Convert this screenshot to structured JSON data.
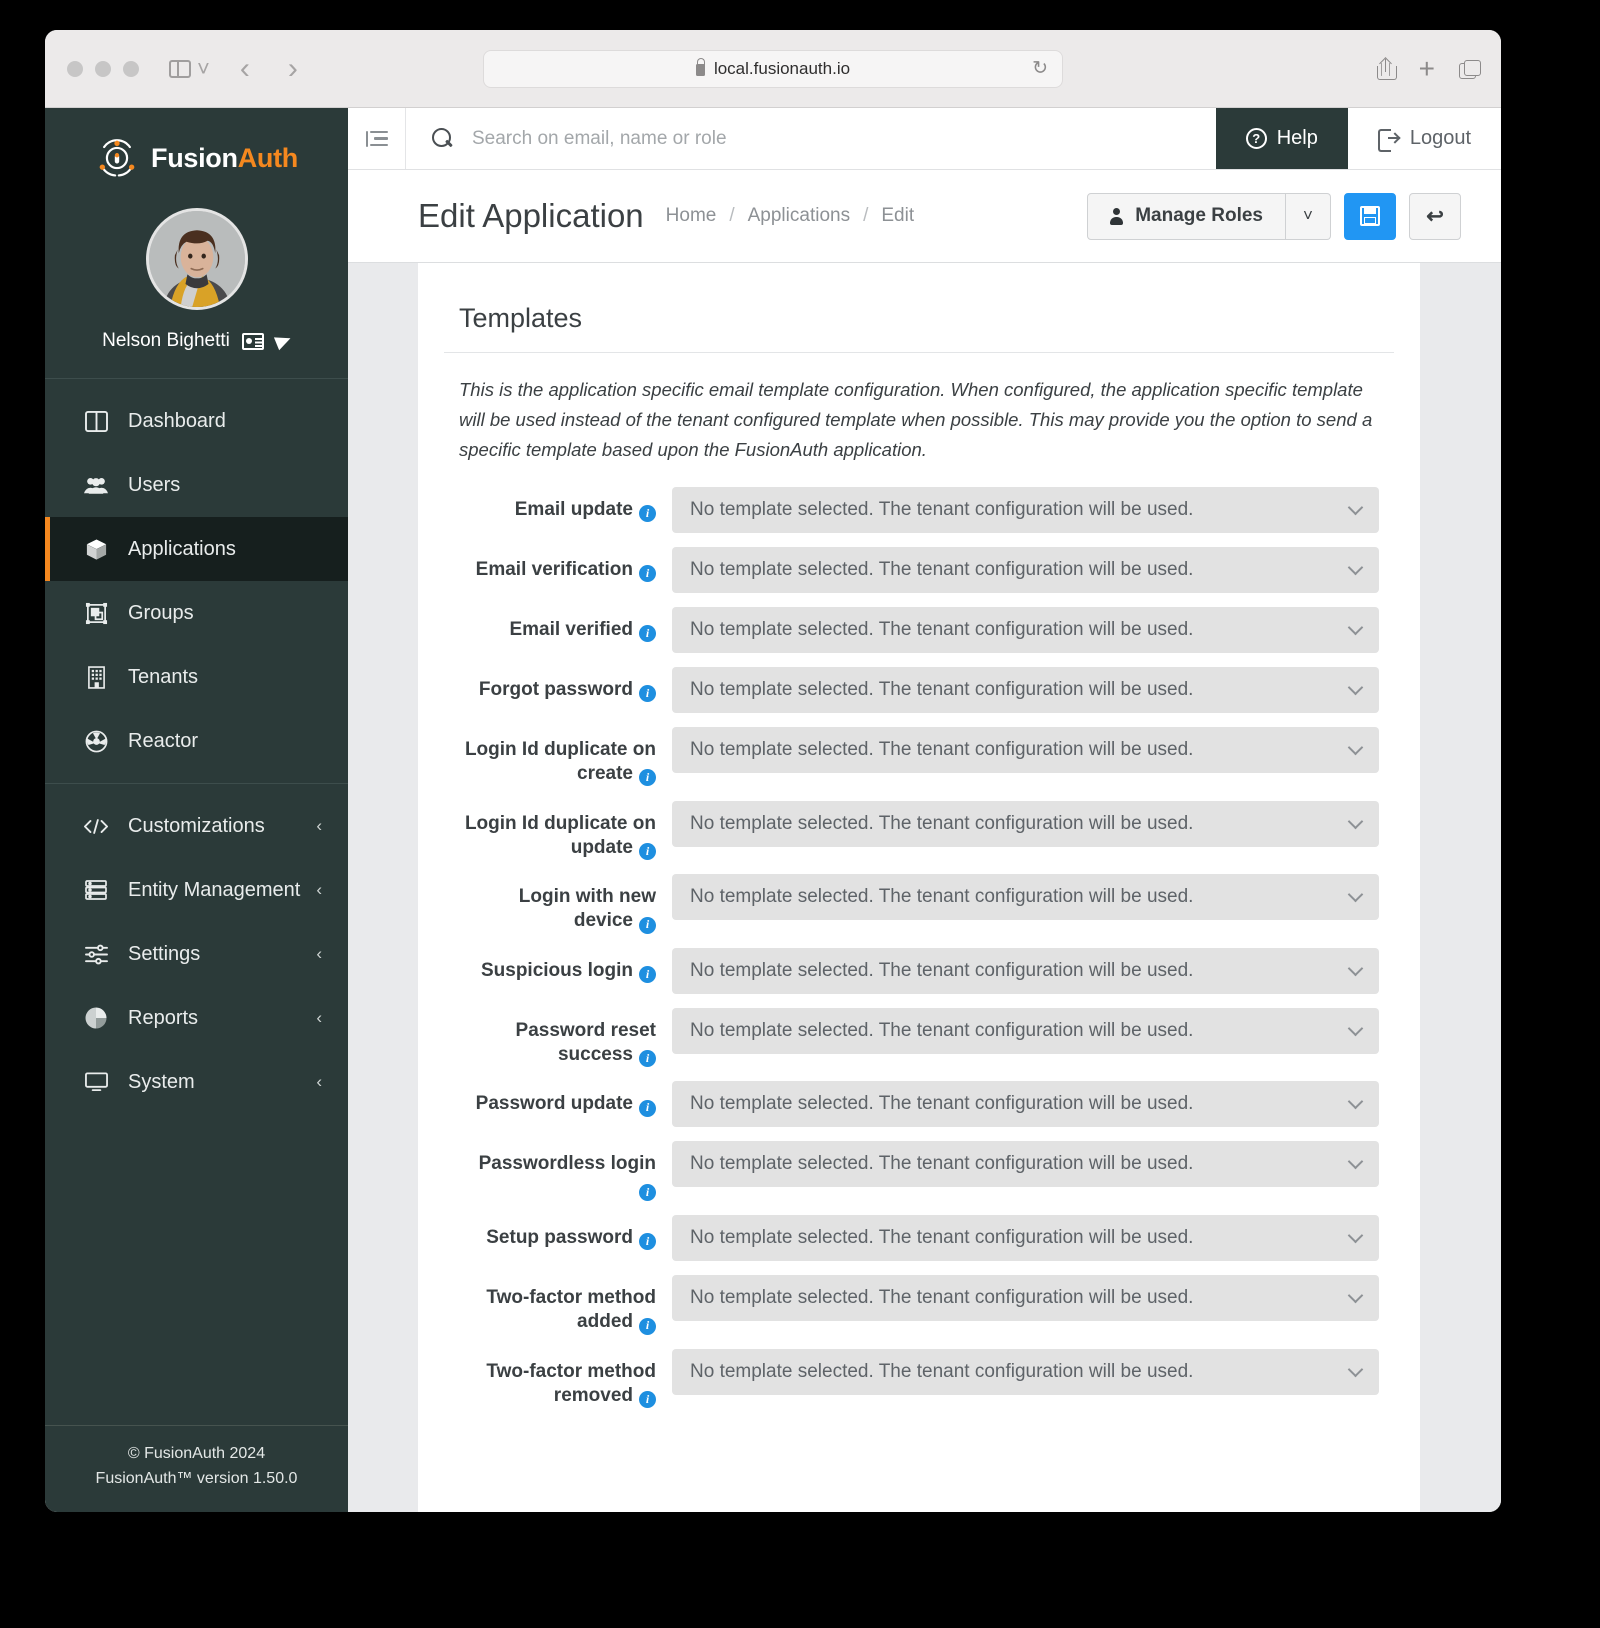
{
  "browser": {
    "url": "local.fusionauth.io",
    "lock_icon": "lock-icon",
    "reload_icon": "reload-icon",
    "share_icon": "share-icon",
    "new_tab_icon": "plus-icon",
    "tabs_icon": "tab-overview-icon",
    "back_icon": "chevron-left-icon",
    "forward_icon": "chevron-right-icon",
    "sidebar_icon": "sidebar-toggle-icon"
  },
  "sidebar": {
    "brand": {
      "first": "Fusion",
      "second": "Auth"
    },
    "user": {
      "name": "Nelson Bighetti",
      "card_icon": "id-card-icon",
      "send_icon": "paper-plane-icon"
    },
    "groups": [
      {
        "items": [
          {
            "label": "Dashboard",
            "icon": "dashboard-icon",
            "active": false,
            "expandable": false
          },
          {
            "label": "Users",
            "icon": "users-icon",
            "active": false,
            "expandable": false
          },
          {
            "label": "Applications",
            "icon": "box-icon",
            "active": true,
            "expandable": false
          },
          {
            "label": "Groups",
            "icon": "groups-icon",
            "active": false,
            "expandable": false
          },
          {
            "label": "Tenants",
            "icon": "building-icon",
            "active": false,
            "expandable": false
          },
          {
            "label": "Reactor",
            "icon": "reactor-icon",
            "active": false,
            "expandable": false
          }
        ]
      },
      {
        "items": [
          {
            "label": "Customizations",
            "icon": "code-icon",
            "active": false,
            "expandable": true
          },
          {
            "label": "Entity Management",
            "icon": "server-icon",
            "active": false,
            "expandable": true
          },
          {
            "label": "Settings",
            "icon": "sliders-icon",
            "active": false,
            "expandable": true
          },
          {
            "label": "Reports",
            "icon": "pie-chart-icon",
            "active": false,
            "expandable": true
          },
          {
            "label": "System",
            "icon": "monitor-icon",
            "active": false,
            "expandable": true
          }
        ]
      }
    ],
    "footer": {
      "copyright": "© FusionAuth 2024",
      "version": "FusionAuth™ version 1.50.0"
    },
    "collapse_chevron": "‹"
  },
  "topbar": {
    "menu_toggle_icon": "menu-collapse-icon",
    "search_icon": "search-icon",
    "search_placeholder": "Search on email, name or role",
    "search_value": "",
    "help_label": "Help",
    "help_icon": "question-circle-icon",
    "logout_label": "Logout",
    "logout_icon": "logout-icon"
  },
  "pagehead": {
    "title": "Edit Application",
    "breadcrumb": [
      "Home",
      "Applications",
      "Edit"
    ],
    "separator": "/",
    "manage_roles_label": "Manage Roles",
    "manage_roles_icon": "person-icon",
    "dropdown_caret": "⌄",
    "save_icon": "save-floppy-icon",
    "back_icon": "undo-arrow-icon",
    "back_glyph": "↩",
    "accent_color": "#2196f3"
  },
  "templates": {
    "section_title": "Templates",
    "description": "This is the application specific email template configuration. When configured, the application specific template will be used instead of the tenant configured template when possible. This may provide you the option to send a specific template based upon the FusionAuth application.",
    "placeholder": "No template selected. The tenant configuration will be used.",
    "info_glyph": "i",
    "rows": [
      {
        "label": "Email update",
        "value": "No template selected. The tenant configuration will be used."
      },
      {
        "label": "Email verification",
        "value": "No template selected. The tenant configuration will be used."
      },
      {
        "label": "Email verified",
        "value": "No template selected. The tenant configuration will be used."
      },
      {
        "label": "Forgot password",
        "value": "No template selected. The tenant configuration will be used."
      },
      {
        "label": "Login Id duplicate on create",
        "value": "No template selected. The tenant configuration will be used."
      },
      {
        "label": "Login Id duplicate on update",
        "value": "No template selected. The tenant configuration will be used."
      },
      {
        "label": "Login with new device",
        "value": "No template selected. The tenant configuration will be used."
      },
      {
        "label": "Suspicious login",
        "value": "No template selected. The tenant configuration will be used."
      },
      {
        "label": "Password reset success",
        "value": "No template selected. The tenant configuration will be used."
      },
      {
        "label": "Password update",
        "value": "No template selected. The tenant configuration will be used."
      },
      {
        "label": "Passwordless login",
        "value": "No template selected. The tenant configuration will be used."
      },
      {
        "label": "Setup password",
        "value": "No template selected. The tenant configuration will be used."
      },
      {
        "label": "Two-factor method added",
        "value": "No template selected. The tenant configuration will be used."
      },
      {
        "label": "Two-factor method removed",
        "value": "No template selected. The tenant configuration will be used."
      }
    ]
  },
  "colors": {
    "sidebar_bg": "#2b3a39",
    "sidebar_active_bg": "#161f1e",
    "accent_orange": "#f5881f",
    "accent_blue": "#2196f3",
    "info_blue": "#1e8fe0",
    "select_bg": "#e2e2e2"
  }
}
